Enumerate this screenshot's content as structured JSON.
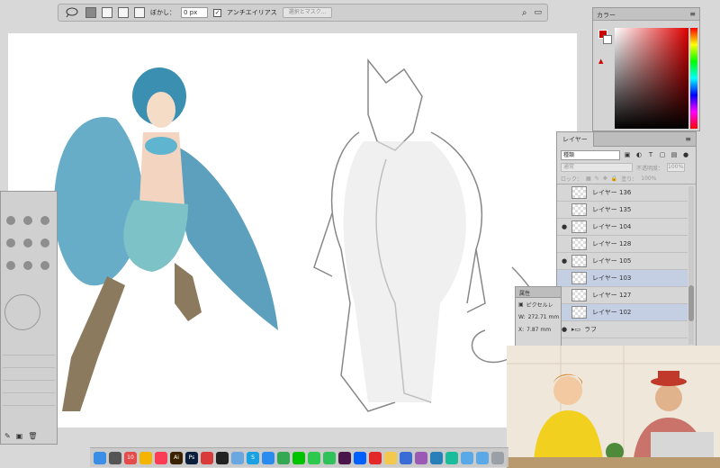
{
  "options_bar": {
    "feather_label": "ぼかし：",
    "feather_value": "0 px",
    "antialias_label": "アンチエイリアス",
    "select_mask_label": "選択とマスク..."
  },
  "color_panel": {
    "title": "カラー",
    "fg_color": "#c80000",
    "bg_color": "#ffffff"
  },
  "layers_panel": {
    "tab": "レイヤー",
    "filter_kind": "種類",
    "blend_mode": "通常",
    "opacity_label": "不透明度：",
    "opacity_value": "100%",
    "lock_label": "ロック：",
    "fill_label": "塗り：",
    "fill_value": "100%",
    "layers": [
      {
        "name": "レイヤー 136",
        "visible": false,
        "selected": false
      },
      {
        "name": "レイヤー 135",
        "visible": false,
        "selected": false
      },
      {
        "name": "レイヤー 104",
        "visible": true,
        "selected": false
      },
      {
        "name": "レイヤー 128",
        "visible": false,
        "selected": false
      },
      {
        "name": "レイヤー 105",
        "visible": true,
        "selected": false
      },
      {
        "name": "レイヤー 103",
        "visible": false,
        "selected": true
      },
      {
        "name": "レイヤー 127",
        "visible": false,
        "selected": false
      },
      {
        "name": "レイヤー 102",
        "visible": false,
        "selected": true
      },
      {
        "name": "ラフ",
        "visible": true,
        "selected": false
      }
    ]
  },
  "properties_panel": {
    "title": "属性",
    "kind": "ピクセルレ",
    "w_label": "W:",
    "w_value": "272.71 mm",
    "x_label": "X:",
    "x_value": "7.87 mm"
  },
  "dock": {
    "apps": [
      {
        "icon": "finder-icon",
        "color": "#3a8ee6",
        "label": ""
      },
      {
        "icon": "launchpad-icon",
        "color": "#555555",
        "label": ""
      },
      {
        "icon": "calendar-icon",
        "color": "#e44b4b",
        "label": "10"
      },
      {
        "icon": "photos-icon",
        "color": "#f4b400",
        "label": ""
      },
      {
        "icon": "music-icon",
        "color": "#fa3c55",
        "label": ""
      },
      {
        "icon": "illustrator-icon",
        "color": "#3a2200",
        "label": "Ai"
      },
      {
        "icon": "photoshop-icon",
        "color": "#0a1f3b",
        "label": "Ps"
      },
      {
        "icon": "app-icon",
        "color": "#d93a3a",
        "label": ""
      },
      {
        "icon": "terminal-icon",
        "color": "#222222",
        "label": ""
      },
      {
        "icon": "preview-icon",
        "color": "#6aa6df",
        "label": ""
      },
      {
        "icon": "skype-icon",
        "color": "#1aa1e3",
        "label": "S"
      },
      {
        "icon": "appstore-icon",
        "color": "#2a8cf0",
        "label": ""
      },
      {
        "icon": "chrome-icon",
        "color": "#34a853",
        "label": ""
      },
      {
        "icon": "line-icon",
        "color": "#00c300",
        "label": ""
      },
      {
        "icon": "messages-icon",
        "color": "#2dc94e",
        "label": ""
      },
      {
        "icon": "facetime-icon",
        "color": "#30c25a",
        "label": ""
      },
      {
        "icon": "slack-icon",
        "color": "#4a154b",
        "label": ""
      },
      {
        "icon": "dropbox-icon",
        "color": "#0061fe",
        "label": ""
      },
      {
        "icon": "opera-icon",
        "color": "#e22828",
        "label": ""
      },
      {
        "icon": "notes-icon",
        "color": "#f2c94c",
        "label": ""
      },
      {
        "icon": "vpn-icon",
        "color": "#3a6cd6",
        "label": ""
      },
      {
        "icon": "game-icon",
        "color": "#9b59b6",
        "label": ""
      },
      {
        "icon": "app2-icon",
        "color": "#2980b9",
        "label": ""
      },
      {
        "icon": "app3-icon",
        "color": "#1abc9c",
        "label": ""
      },
      {
        "icon": "folder-icon",
        "color": "#5aa9e6",
        "label": ""
      },
      {
        "icon": "folder2-icon",
        "color": "#5aa9e6",
        "label": ""
      },
      {
        "icon": "trash-icon",
        "color": "#9aa0a6",
        "label": ""
      }
    ]
  }
}
